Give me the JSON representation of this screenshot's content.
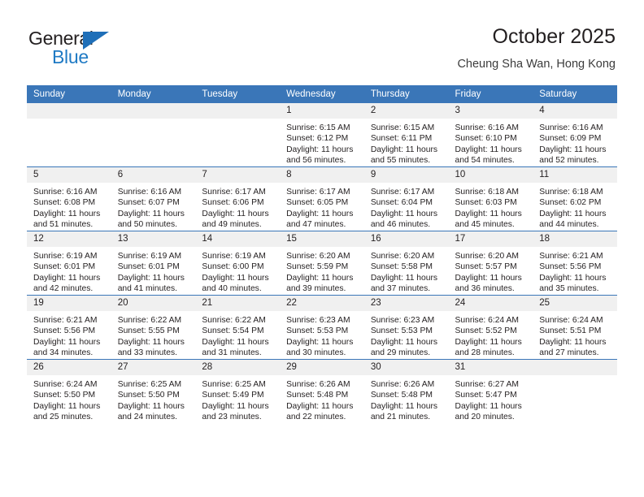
{
  "brand": {
    "name_top": "General",
    "name_bottom": "Blue",
    "accent_color": "#1f7ac4"
  },
  "header": {
    "title": "October 2025",
    "subtitle": "Cheung Sha Wan, Hong Kong",
    "header_bg_color": "#3a76b8",
    "header_text_color": "#ffffff"
  },
  "calendar": {
    "weekdays": [
      "Sunday",
      "Monday",
      "Tuesday",
      "Wednesday",
      "Thursday",
      "Friday",
      "Saturday"
    ],
    "weeks": [
      [
        {
          "day": "",
          "sunrise": "",
          "sunset": "",
          "daylight": ""
        },
        {
          "day": "",
          "sunrise": "",
          "sunset": "",
          "daylight": ""
        },
        {
          "day": "",
          "sunrise": "",
          "sunset": "",
          "daylight": ""
        },
        {
          "day": "1",
          "sunrise": "Sunrise: 6:15 AM",
          "sunset": "Sunset: 6:12 PM",
          "daylight": "Daylight: 11 hours and 56 minutes."
        },
        {
          "day": "2",
          "sunrise": "Sunrise: 6:15 AM",
          "sunset": "Sunset: 6:11 PM",
          "daylight": "Daylight: 11 hours and 55 minutes."
        },
        {
          "day": "3",
          "sunrise": "Sunrise: 6:16 AM",
          "sunset": "Sunset: 6:10 PM",
          "daylight": "Daylight: 11 hours and 54 minutes."
        },
        {
          "day": "4",
          "sunrise": "Sunrise: 6:16 AM",
          "sunset": "Sunset: 6:09 PM",
          "daylight": "Daylight: 11 hours and 52 minutes."
        }
      ],
      [
        {
          "day": "5",
          "sunrise": "Sunrise: 6:16 AM",
          "sunset": "Sunset: 6:08 PM",
          "daylight": "Daylight: 11 hours and 51 minutes."
        },
        {
          "day": "6",
          "sunrise": "Sunrise: 6:16 AM",
          "sunset": "Sunset: 6:07 PM",
          "daylight": "Daylight: 11 hours and 50 minutes."
        },
        {
          "day": "7",
          "sunrise": "Sunrise: 6:17 AM",
          "sunset": "Sunset: 6:06 PM",
          "daylight": "Daylight: 11 hours and 49 minutes."
        },
        {
          "day": "8",
          "sunrise": "Sunrise: 6:17 AM",
          "sunset": "Sunset: 6:05 PM",
          "daylight": "Daylight: 11 hours and 47 minutes."
        },
        {
          "day": "9",
          "sunrise": "Sunrise: 6:17 AM",
          "sunset": "Sunset: 6:04 PM",
          "daylight": "Daylight: 11 hours and 46 minutes."
        },
        {
          "day": "10",
          "sunrise": "Sunrise: 6:18 AM",
          "sunset": "Sunset: 6:03 PM",
          "daylight": "Daylight: 11 hours and 45 minutes."
        },
        {
          "day": "11",
          "sunrise": "Sunrise: 6:18 AM",
          "sunset": "Sunset: 6:02 PM",
          "daylight": "Daylight: 11 hours and 44 minutes."
        }
      ],
      [
        {
          "day": "12",
          "sunrise": "Sunrise: 6:19 AM",
          "sunset": "Sunset: 6:01 PM",
          "daylight": "Daylight: 11 hours and 42 minutes."
        },
        {
          "day": "13",
          "sunrise": "Sunrise: 6:19 AM",
          "sunset": "Sunset: 6:01 PM",
          "daylight": "Daylight: 11 hours and 41 minutes."
        },
        {
          "day": "14",
          "sunrise": "Sunrise: 6:19 AM",
          "sunset": "Sunset: 6:00 PM",
          "daylight": "Daylight: 11 hours and 40 minutes."
        },
        {
          "day": "15",
          "sunrise": "Sunrise: 6:20 AM",
          "sunset": "Sunset: 5:59 PM",
          "daylight": "Daylight: 11 hours and 39 minutes."
        },
        {
          "day": "16",
          "sunrise": "Sunrise: 6:20 AM",
          "sunset": "Sunset: 5:58 PM",
          "daylight": "Daylight: 11 hours and 37 minutes."
        },
        {
          "day": "17",
          "sunrise": "Sunrise: 6:20 AM",
          "sunset": "Sunset: 5:57 PM",
          "daylight": "Daylight: 11 hours and 36 minutes."
        },
        {
          "day": "18",
          "sunrise": "Sunrise: 6:21 AM",
          "sunset": "Sunset: 5:56 PM",
          "daylight": "Daylight: 11 hours and 35 minutes."
        }
      ],
      [
        {
          "day": "19",
          "sunrise": "Sunrise: 6:21 AM",
          "sunset": "Sunset: 5:56 PM",
          "daylight": "Daylight: 11 hours and 34 minutes."
        },
        {
          "day": "20",
          "sunrise": "Sunrise: 6:22 AM",
          "sunset": "Sunset: 5:55 PM",
          "daylight": "Daylight: 11 hours and 33 minutes."
        },
        {
          "day": "21",
          "sunrise": "Sunrise: 6:22 AM",
          "sunset": "Sunset: 5:54 PM",
          "daylight": "Daylight: 11 hours and 31 minutes."
        },
        {
          "day": "22",
          "sunrise": "Sunrise: 6:23 AM",
          "sunset": "Sunset: 5:53 PM",
          "daylight": "Daylight: 11 hours and 30 minutes."
        },
        {
          "day": "23",
          "sunrise": "Sunrise: 6:23 AM",
          "sunset": "Sunset: 5:53 PM",
          "daylight": "Daylight: 11 hours and 29 minutes."
        },
        {
          "day": "24",
          "sunrise": "Sunrise: 6:24 AM",
          "sunset": "Sunset: 5:52 PM",
          "daylight": "Daylight: 11 hours and 28 minutes."
        },
        {
          "day": "25",
          "sunrise": "Sunrise: 6:24 AM",
          "sunset": "Sunset: 5:51 PM",
          "daylight": "Daylight: 11 hours and 27 minutes."
        }
      ],
      [
        {
          "day": "26",
          "sunrise": "Sunrise: 6:24 AM",
          "sunset": "Sunset: 5:50 PM",
          "daylight": "Daylight: 11 hours and 25 minutes."
        },
        {
          "day": "27",
          "sunrise": "Sunrise: 6:25 AM",
          "sunset": "Sunset: 5:50 PM",
          "daylight": "Daylight: 11 hours and 24 minutes."
        },
        {
          "day": "28",
          "sunrise": "Sunrise: 6:25 AM",
          "sunset": "Sunset: 5:49 PM",
          "daylight": "Daylight: 11 hours and 23 minutes."
        },
        {
          "day": "29",
          "sunrise": "Sunrise: 6:26 AM",
          "sunset": "Sunset: 5:48 PM",
          "daylight": "Daylight: 11 hours and 22 minutes."
        },
        {
          "day": "30",
          "sunrise": "Sunrise: 6:26 AM",
          "sunset": "Sunset: 5:48 PM",
          "daylight": "Daylight: 11 hours and 21 minutes."
        },
        {
          "day": "31",
          "sunrise": "Sunrise: 6:27 AM",
          "sunset": "Sunset: 5:47 PM",
          "daylight": "Daylight: 11 hours and 20 minutes."
        },
        {
          "day": "",
          "sunrise": "",
          "sunset": "",
          "daylight": ""
        }
      ]
    ]
  }
}
